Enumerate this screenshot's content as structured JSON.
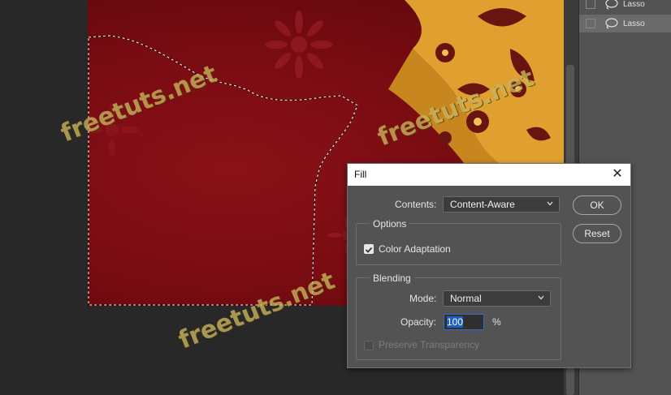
{
  "history": {
    "items": [
      {
        "label": "Lasso"
      },
      {
        "label": "Lasso"
      }
    ]
  },
  "watermark": "freetuts.net",
  "fill_dialog": {
    "title": "Fill",
    "contents_label": "Contents:",
    "contents_value": "Content-Aware",
    "options_title": "Options",
    "color_adaptation_label": "Color Adaptation",
    "color_adaptation_checked": true,
    "blending_title": "Blending",
    "mode_label": "Mode:",
    "mode_value": "Normal",
    "opacity_label": "Opacity:",
    "opacity_value": "100",
    "opacity_unit": "%",
    "preserve_transparency_label": "Preserve Transparency",
    "ok_label": "OK",
    "reset_label": "Reset"
  },
  "colors": {
    "canvas_red": "#7a0c12",
    "ornament_gold": "#e0a030",
    "dialog_bg": "#535353",
    "watermark": "#c9b35a"
  }
}
